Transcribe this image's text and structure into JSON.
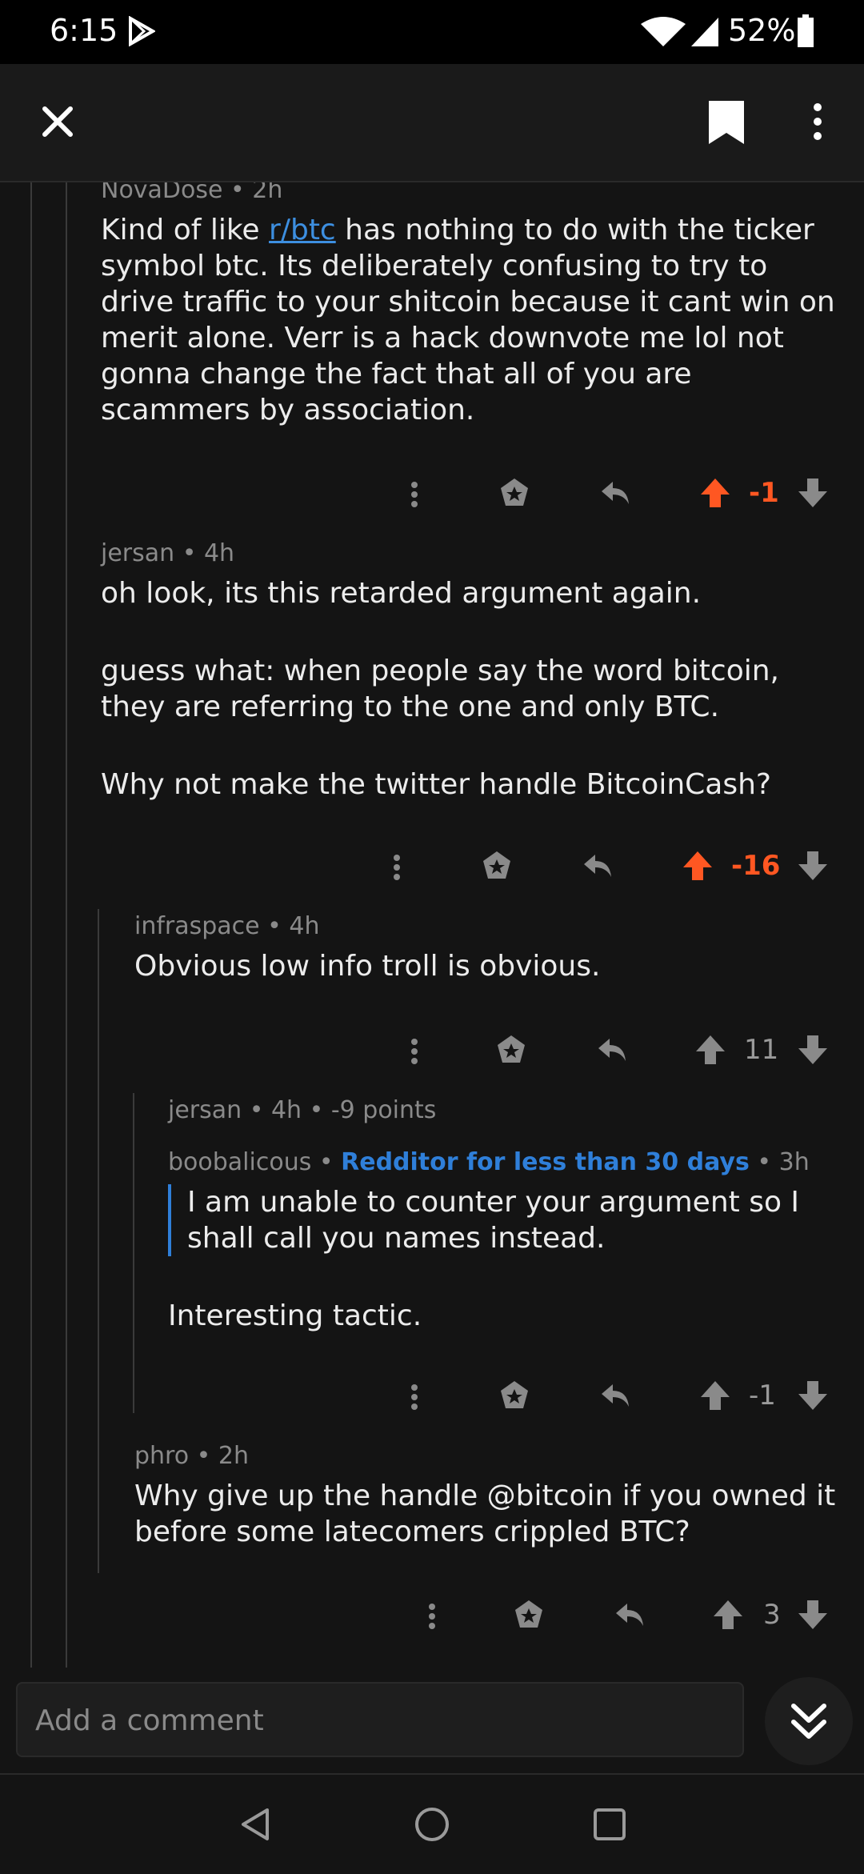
{
  "status_bar": {
    "time": "6:15",
    "battery": "52%"
  },
  "comments": [
    {
      "author": "NovaDose",
      "time": "2h",
      "body_parts": [
        "Kind of like ",
        "r/btc",
        " has nothing to do with the ticker symbol btc.  Its deliberately confusing to try to drive traffic to your shitcoin because it cant win on merit alone.  Verr is a hack downvote me lol not gonna change the fact that all of you are scammers by association."
      ],
      "score": "-1"
    },
    {
      "author": "jersan",
      "time": "4h",
      "paragraphs": [
        "oh look, its this retarded argument again.",
        "guess what:  when people say the word bitcoin, they are referring to the one and only BTC.",
        "Why not make the twitter handle BitcoinCash?"
      ],
      "score": "-16"
    },
    {
      "author": "infraspace",
      "time": "4h",
      "body": "Obvious low info troll is obvious.",
      "score": "11"
    },
    {
      "author": "jersan",
      "time": "4h",
      "points": "-9 points",
      "quoted_author": "boobalicous",
      "quoted_flair": "Redditor for less than 30 days",
      "quoted_time": "3h",
      "quote": "I am unable to counter your argument so I shall call you names instead.",
      "body": "Interesting tactic.",
      "score": "-1"
    },
    {
      "author": "phro",
      "time": "2h",
      "body": "Why give up the handle @bitcoin if you owned it before some latecomers crippled BTC?",
      "score": "3"
    }
  ],
  "composer": {
    "placeholder": "Add a comment"
  },
  "colors": {
    "downvoted": "#ff5722",
    "link": "#3d8fe0",
    "flair": "#2f7fd9"
  },
  "icons": [
    "close-icon",
    "bookmark-icon",
    "more-vertical-icon",
    "award-icon",
    "reply-icon",
    "upvote-icon",
    "downvote-icon",
    "scroll-down-icon"
  ]
}
